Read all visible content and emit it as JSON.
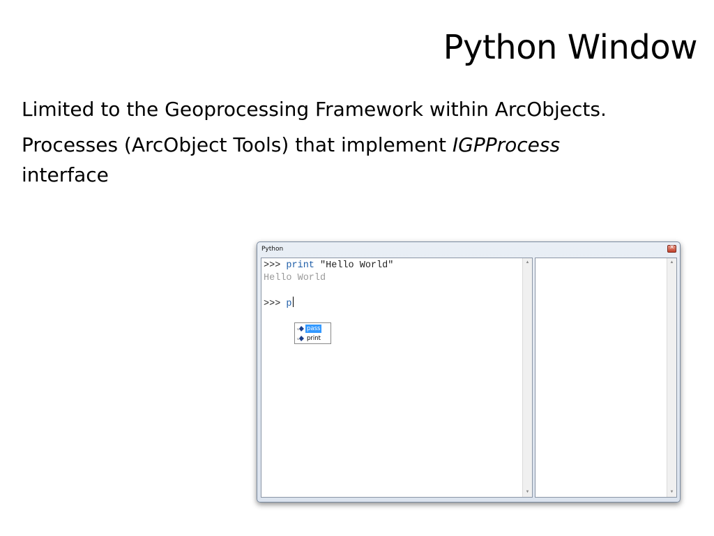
{
  "slide": {
    "title": "Python Window",
    "bullets": [
      {
        "text": "Limited to the Geoprocessing Framework within ArcObjects."
      },
      {
        "pre": "Processes (ArcObject Tools) that implement ",
        "em": "IGPProcess",
        "post": " interface"
      }
    ]
  },
  "window": {
    "title": "Python",
    "console": {
      "line1_prompt": ">>> ",
      "line1_keyword": "print",
      "line1_rest": " \"Hello World\"",
      "output": "Hello World",
      "line3_prompt": ">>> ",
      "line3_typed": "p"
    },
    "autocomplete": {
      "items": [
        {
          "label": "pass",
          "selected": true,
          "icon": "keyword-icon"
        },
        {
          "label": "print",
          "selected": false,
          "icon": "keyword-icon"
        }
      ]
    }
  },
  "colors": {
    "keyword": "#1f5ea8",
    "output": "#9a9a9a",
    "selection": "#3399ff"
  }
}
